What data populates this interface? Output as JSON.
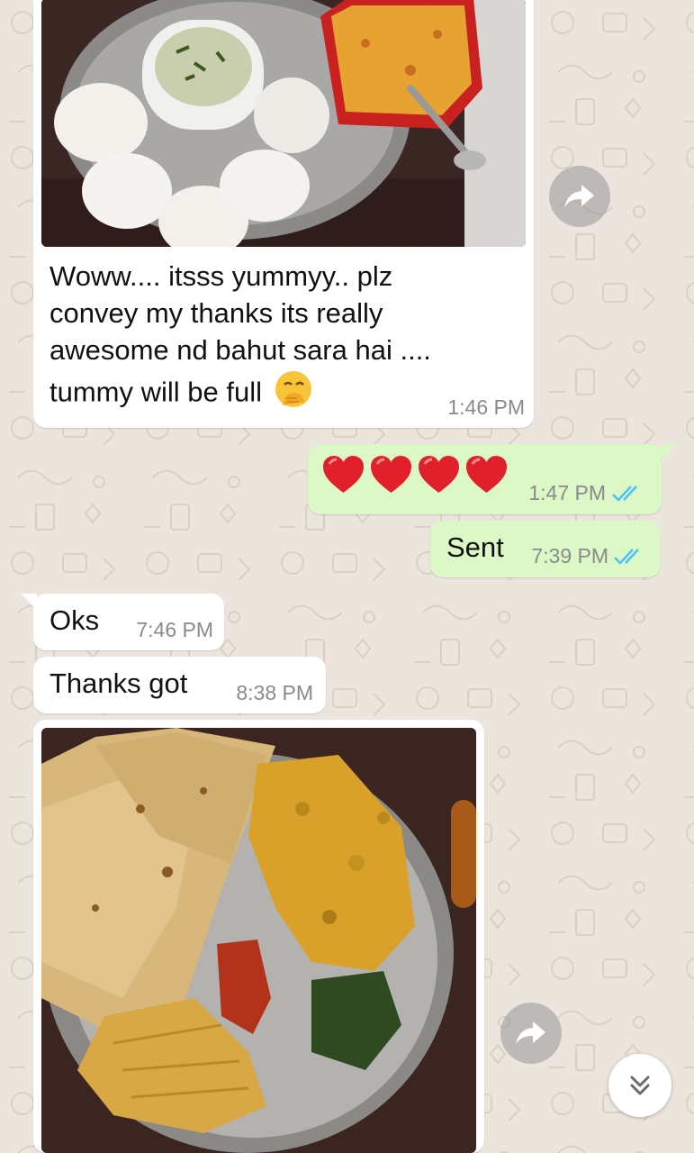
{
  "chat": {
    "messages": [
      {
        "direction": "incoming",
        "type": "image+text",
        "image_icon": "idli-plate-photo",
        "text": "Woww.... itsss yummyy.. plz convey my thanks its really awesome nd bahut sara hai .... tummy will be full",
        "emoji_icon": "hand-over-mouth-emoji",
        "time": "1:46 PM"
      },
      {
        "direction": "outgoing",
        "type": "emoji",
        "emoji_icon": "red-heart-emoji",
        "emoji_count": 4,
        "time": "1:47 PM",
        "status_icon": "double-check-read-icon"
      },
      {
        "direction": "outgoing",
        "type": "text",
        "text": "Sent",
        "time": "7:39 PM",
        "status_icon": "double-check-read-icon"
      },
      {
        "direction": "incoming",
        "type": "text",
        "text": "Oks",
        "time": "7:46 PM"
      },
      {
        "direction": "incoming",
        "type": "text",
        "text": "Thanks got",
        "time": "8:38 PM"
      },
      {
        "direction": "incoming",
        "type": "image",
        "image_icon": "roti-sabzi-plate-photo"
      }
    ]
  },
  "colors": {
    "wallpaper": "#ece5dd",
    "incoming_bubble": "#ffffff",
    "outgoing_bubble": "#dcf8c6",
    "read_tick": "#4fc3f7",
    "timestamp": "#8a8a8a"
  },
  "icons": {
    "forward": "forward-arrow-icon",
    "scroll_down": "double-chevron-down-icon"
  }
}
